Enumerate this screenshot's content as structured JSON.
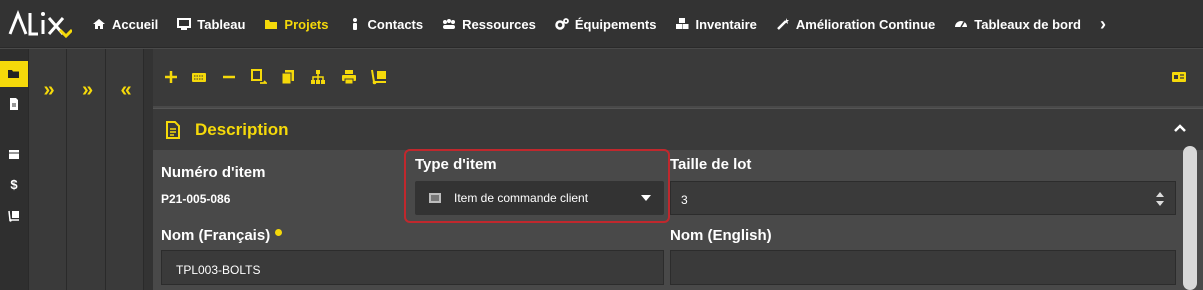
{
  "app": {
    "logo_text": "ALIX"
  },
  "nav": {
    "items": [
      {
        "label": "Accueil",
        "icon": "home-icon"
      },
      {
        "label": "Tableau",
        "icon": "monitor-icon"
      },
      {
        "label": "Projets",
        "icon": "folder-icon",
        "active": true
      },
      {
        "label": "Contacts",
        "icon": "person-icon"
      },
      {
        "label": "Ressources",
        "icon": "users-icon"
      },
      {
        "label": "Équipements",
        "icon": "cogs-icon"
      },
      {
        "label": "Inventaire",
        "icon": "boxes-icon"
      },
      {
        "label": "Amélioration Continue",
        "icon": "wand-icon"
      },
      {
        "label": "Tableaux de bord",
        "icon": "gauge-icon"
      }
    ],
    "more": "›"
  },
  "sidebar": {
    "icons": [
      "folder-open-icon",
      "file-icon",
      "box-icon",
      "dollar-icon",
      "dolly-icon"
    ],
    "dollar_glyph": "$"
  },
  "columns": {
    "expand1": "»",
    "expand2": "»",
    "collapse": "«"
  },
  "toolbar": {
    "icons": [
      "add-icon",
      "keyboard-icon",
      "remove-icon",
      "copy-to-icon",
      "duplicate-icon",
      "hierarchy-icon",
      "print-icon",
      "dolly-icon"
    ],
    "right_icon": "id-card-icon"
  },
  "section": {
    "title": "Description"
  },
  "form": {
    "item_number_label": "Numéro d'item",
    "item_number_value": "P21-005-086",
    "item_type_label": "Type d'item",
    "item_type_value": "Item de commande client",
    "lot_size_label": "Taille de lot",
    "lot_size_value": "3",
    "name_fr_label": "Nom (Français)",
    "name_fr_value": "TPL003-BOLTS",
    "name_en_label": "Nom (English)",
    "name_en_value": ""
  },
  "colors": {
    "accent": "#f5d90a",
    "highlight": "#c0282d",
    "background": "#4a4a4a",
    "topbar": "#333333"
  }
}
